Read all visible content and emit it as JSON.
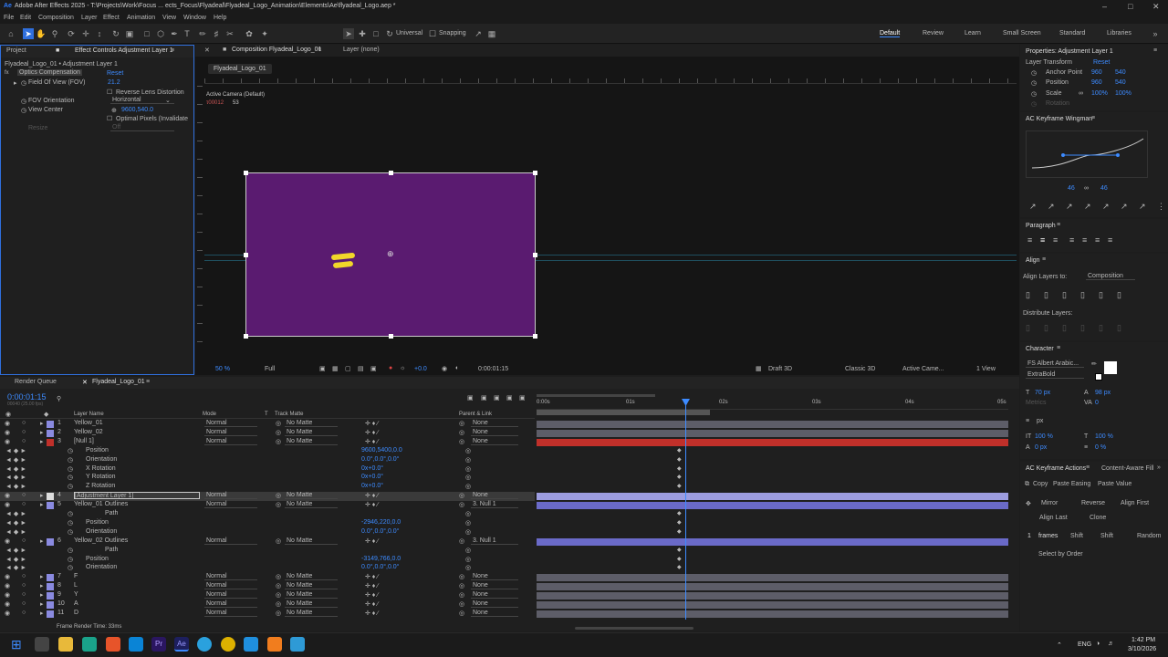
{
  "window": {
    "title": "Adobe After Effects 2025 - T:\\Projects\\Work\\Focus ... ects_Focus\\Flyadeal\\Flyadeal_Logo_Animation\\Elements\\Ae\\flyadeal_Logo.aep *"
  },
  "menu": [
    "File",
    "Edit",
    "Composition",
    "Layer",
    "Effect",
    "Animation",
    "View",
    "Window",
    "Help"
  ],
  "toolbar": {
    "universal": "Universal",
    "snapping": "Snapping"
  },
  "workspaces": [
    "Default",
    "Review",
    "Learn",
    "Small Screen",
    "Standard",
    "Libraries"
  ],
  "project_panel": {
    "tab_project": "Project",
    "tab_effect": "Effect Controls Adjustment Layer 1",
    "subtitle": "Flyadeal_Logo_01 • Adjustment Layer 1",
    "optics_label": "Optics Compensation",
    "reset": "Reset",
    "props": [
      {
        "name": "Field Of View (FOV)",
        "value": "21.2"
      },
      {
        "name": "Reverse Lens Distortion",
        "value": ""
      },
      {
        "name": "FOV Orientation",
        "value": "Horizontal"
      },
      {
        "name": "View Center",
        "value": "9600,540.0"
      },
      {
        "name": "Optimal Pixels (Invalidate",
        "value": ""
      },
      {
        "name": "Resize",
        "value": "Off"
      }
    ]
  },
  "comp_panel": {
    "tab": "Composition Flyadeal_Logo_01",
    "layer_tab": "Layer (none)",
    "breadcrumb": "Flyadeal_Logo_01",
    "camera_label": "Active Camera (Default)",
    "readout1": "τ00012",
    "readout2": "53",
    "zoom": "50 %",
    "res": "Full",
    "exposure": "+0.0",
    "timecode": "0:00:01:15",
    "draft": "Draft 3D",
    "renderer": "Classic 3D",
    "view": "Active Came...",
    "views": "1 View"
  },
  "properties": {
    "title": "Properties: Adjustment Layer 1",
    "section": "Layer Transform",
    "reset": "Reset",
    "rows": [
      {
        "name": "Anchor Point",
        "v1": "960",
        "v2": "540"
      },
      {
        "name": "Position",
        "v1": "960",
        "v2": "540"
      },
      {
        "name": "Scale",
        "v1": "100%",
        "v2": "100%"
      },
      {
        "name": "Rotation",
        "v1": "",
        "v2": ""
      }
    ]
  },
  "wingman": {
    "title": "AC Keyframe Wingman",
    "left": "46",
    "right": "46"
  },
  "paragraph": {
    "title": "Paragraph"
  },
  "align": {
    "title": "Align",
    "align_to_label": "Align Layers to:",
    "align_to": "Composition",
    "distribute": "Distribute Layers:"
  },
  "character": {
    "title": "Character",
    "font": "FS Albert Arabic...",
    "style": "ExtraBold",
    "size": "70 px",
    "leading": "98 px",
    "tracking": "0",
    "metrics": "Metrics",
    "unit": "px",
    "vscale": "100 %",
    "hscale": "100 %",
    "baseline": "0 px",
    "tsume": "0 %"
  },
  "keyframe_actions": {
    "title": "AC Keyframe Actions",
    "tab2": "Content-Aware Fill",
    "copy": "Copy",
    "paste_easing": "Paste Easing",
    "paste_value": "Paste Value",
    "mirror": "Mirror",
    "reverse": "Reverse",
    "align_first": "Align First",
    "align_last": "Align Last",
    "clone": "Clone",
    "frames_num": "1",
    "frames": "frames",
    "shift1": "Shift",
    "shift2": "Shift",
    "random": "Random",
    "select_order": "Select by Order"
  },
  "timeline": {
    "tab_rq": "Render Queue",
    "tab_comp": "Flyadeal_Logo_01",
    "timecode": "0:00:01:15",
    "fps": "00040 (25.00 fps)",
    "headers": {
      "layer": "Layer Name",
      "mode": "Mode",
      "t": "T",
      "track": "Track Matte",
      "parent": "Parent & Link"
    },
    "ruler": [
      "0:00s",
      "01s",
      "02s",
      "03s",
      "04s",
      "05s"
    ],
    "render_time": "Frame Render Time: 33ms",
    "rows": [
      {
        "num": "1",
        "name": "Yellow_01",
        "mode": "Normal",
        "matte": "No Matte",
        "parent": "None"
      },
      {
        "num": "2",
        "name": "Yellow_02",
        "mode": "Normal",
        "matte": "No Matte",
        "parent": "None"
      },
      {
        "num": "3",
        "name": "[Null 1]",
        "mode": "Normal",
        "matte": "No Matte",
        "parent": "None"
      },
      {
        "prop": "Position",
        "value": "9600,5400,0.0"
      },
      {
        "prop": "Orientation",
        "value": "0.0°,0.0°,0.0°"
      },
      {
        "prop": "X Rotation",
        "value": "0x+0.0°"
      },
      {
        "prop": "Y Rotation",
        "value": "0x+0.0°"
      },
      {
        "prop": "Z Rotation",
        "value": "0x+0.0°"
      },
      {
        "num": "4",
        "name": "[Adjustment Layer 1]",
        "mode": "Normal",
        "matte": "No Matte",
        "parent": "None"
      },
      {
        "num": "5",
        "name": "Yellow_01 Outlines",
        "mode": "Normal",
        "matte": "No Matte",
        "parent": "3. Null 1"
      },
      {
        "prop": "Path",
        "value": ""
      },
      {
        "prop": "Position",
        "value": "-2946,220,0.0"
      },
      {
        "prop": "Orientation",
        "value": "0.0°,0.0°,0.0°"
      },
      {
        "num": "6",
        "name": "Yellow_02 Outlines",
        "mode": "Normal",
        "matte": "No Matte",
        "parent": "3. Null 1"
      },
      {
        "prop": "Path",
        "value": ""
      },
      {
        "prop": "Position",
        "value": "-3149,766,0.0"
      },
      {
        "prop": "Orientation",
        "value": "0.0°,0.0°,0.0°"
      },
      {
        "num": "7",
        "name": "F",
        "mode": "Normal",
        "matte": "No Matte",
        "parent": "None"
      },
      {
        "num": "8",
        "name": "L",
        "mode": "Normal",
        "matte": "No Matte",
        "parent": "None"
      },
      {
        "num": "9",
        "name": "Y",
        "mode": "Normal",
        "matte": "No Matte",
        "parent": "None"
      },
      {
        "num": "10",
        "name": "A",
        "mode": "Normal",
        "matte": "No Matte",
        "parent": "None"
      },
      {
        "num": "11",
        "name": "D",
        "mode": "Normal",
        "matte": "No Matte",
        "parent": "None"
      }
    ]
  },
  "taskbar": {
    "time": "1:42 PM",
    "date": "3/10/2026",
    "lang": "ENG"
  },
  "colors": {
    "comp_bg": "#5a1b70",
    "layer_yellow": "#f1d72a",
    "accent": "#2f6fdd",
    "null_track": "#c0302a",
    "track_purple": "#8a8ae0"
  }
}
